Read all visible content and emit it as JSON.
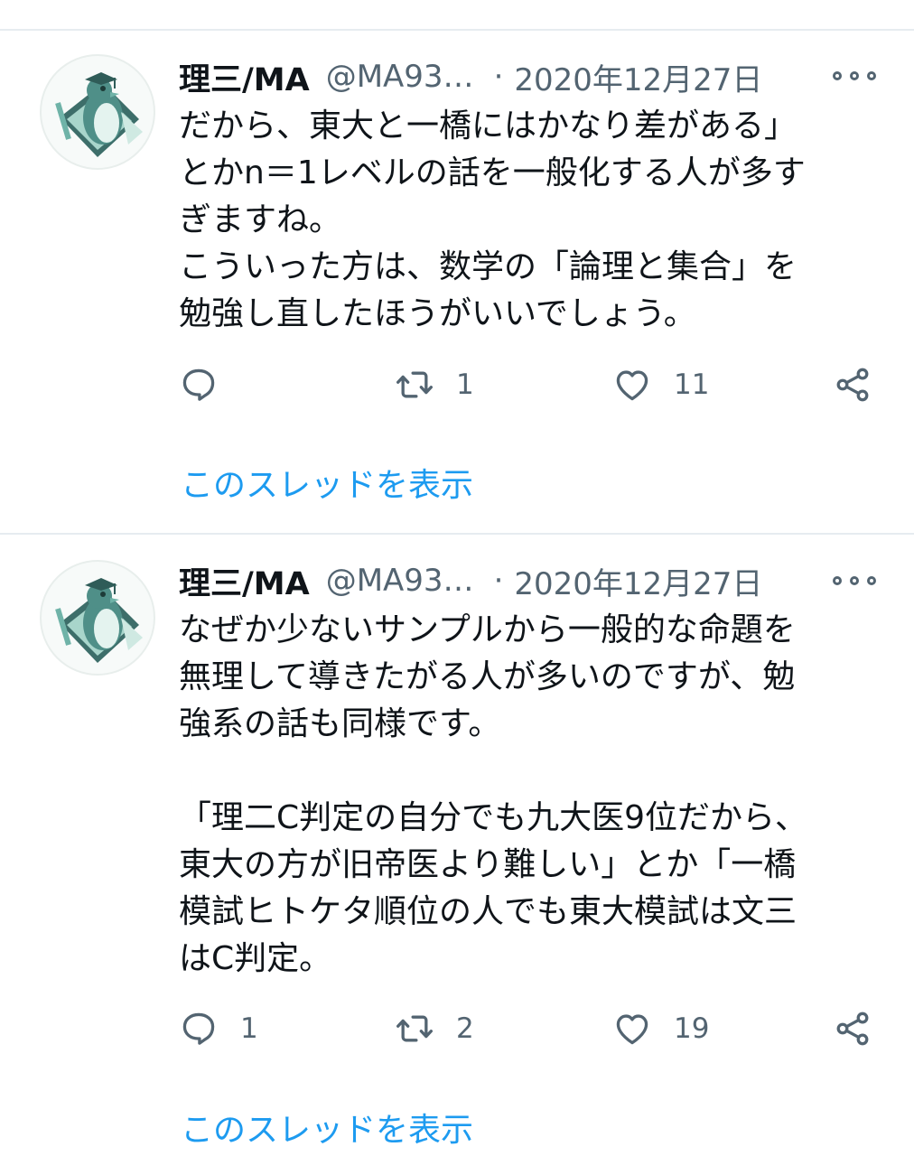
{
  "colors": {
    "accent": "#1d9bf0",
    "secondary_text": "#536471",
    "divider": "#e6ecf0"
  },
  "tweets": [
    {
      "author": {
        "name": "理三/MA",
        "handle": "@MA93…",
        "avatar": "penguin-with-graduation-cap"
      },
      "separator": "·",
      "date": "2020年12月27日",
      "lines": [
        "だから、東大と一橋にはかなり差がある」",
        "とかn＝1レベルの話を一般化する人が多す",
        "ぎますね。",
        "こういった方は、数学の「論理と集合」を",
        "勉強し直したほうがいいでしょう。"
      ],
      "actions": {
        "replies": "",
        "retweets": "1",
        "likes": "11"
      },
      "thread_link": "このスレッドを表示"
    },
    {
      "author": {
        "name": "理三/MA",
        "handle": "@MA93…",
        "avatar": "penguin-with-graduation-cap"
      },
      "separator": "·",
      "date": "2020年12月27日",
      "lines": [
        "なぜか少ないサンプルから一般的な命題を",
        "無理して導きたがる人が多いのですが、勉",
        "強系の話も同様です。",
        "",
        "「理二C判定の自分でも九大医9位だから、",
        "東大の方が旧帝医より難しい」とか「一橋",
        "模試ヒトケタ順位の人でも東大模試は文三",
        "はC判定。"
      ],
      "actions": {
        "replies": "1",
        "retweets": "2",
        "likes": "19"
      },
      "thread_link": "このスレッドを表示"
    }
  ],
  "icons": {
    "reply": "reply-bubble-icon",
    "retweet": "retweet-arrows-icon",
    "like": "heart-icon",
    "share": "share-nodes-icon",
    "more": "more-dots-icon"
  }
}
